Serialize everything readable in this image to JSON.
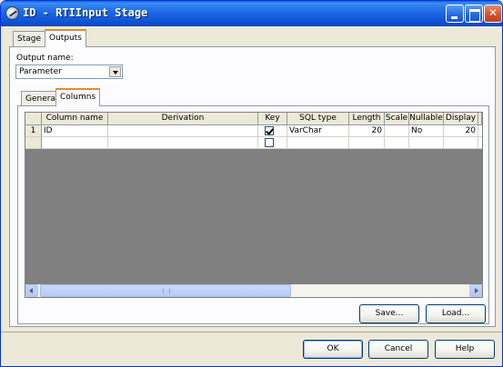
{
  "window": {
    "title": "ID - RTIInput Stage"
  },
  "tabs": [
    {
      "label": "Stage",
      "active": false
    },
    {
      "label": "Outputs",
      "active": true
    }
  ],
  "output_name": {
    "label": "Output name:",
    "value": "Parameter"
  },
  "inner_tabs": [
    {
      "label": "General",
      "active": false
    },
    {
      "label": "Columns",
      "active": true
    }
  ],
  "grid": {
    "columns": [
      "Column name",
      "Derivation",
      "Key",
      "SQL type",
      "Length",
      "Scale",
      "Nullable",
      "Display"
    ],
    "rows": [
      {
        "row_header": "1",
        "column_name": "ID",
        "derivation": "",
        "key": true,
        "sql_type": "VarChar",
        "length": "20",
        "scale": "",
        "nullable": "No",
        "display": "20"
      },
      {
        "row_header": "",
        "column_name": "",
        "derivation": "",
        "key": false,
        "sql_type": "",
        "length": "",
        "scale": "",
        "nullable": "",
        "display": ""
      }
    ]
  },
  "buttons": {
    "save": "Save...",
    "load": "Load...",
    "ok": "OK",
    "cancel": "Cancel",
    "help": "Help"
  },
  "colors": {
    "titlebar": "#0a5fd8",
    "dialog_bg": "#ece9d8",
    "grid_empty": "#808080",
    "active_tab_accent": "#e68b2c"
  }
}
